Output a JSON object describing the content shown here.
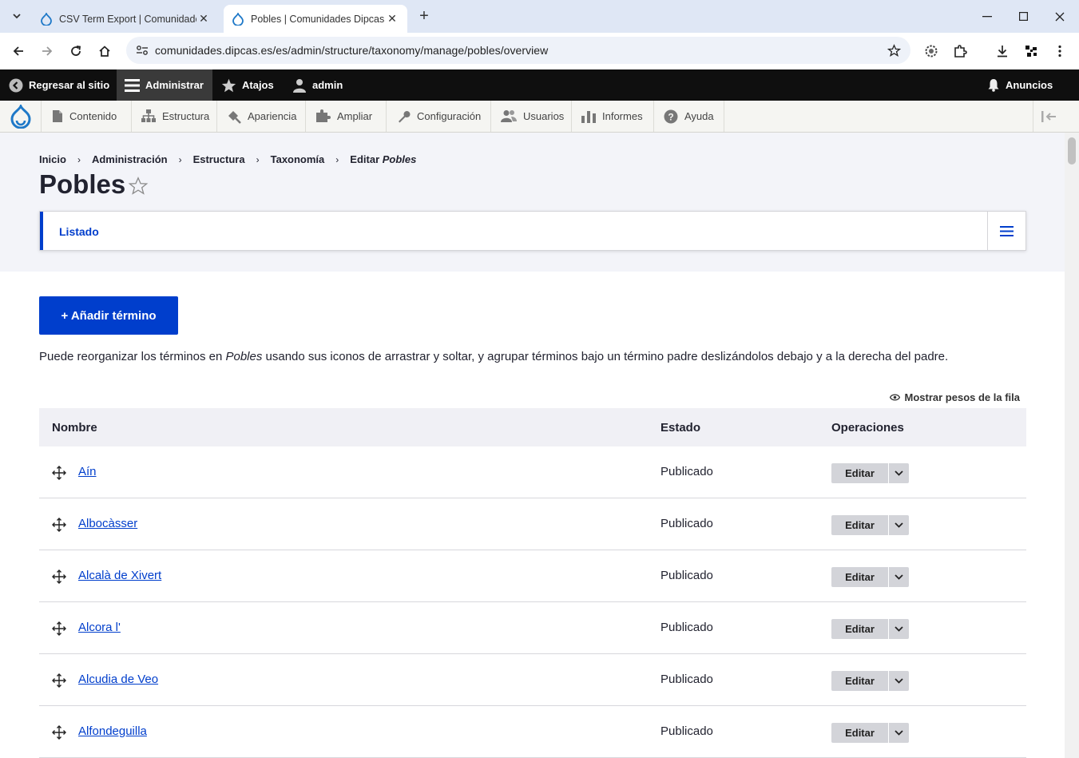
{
  "browser": {
    "tabs": [
      {
        "title": "CSV Term Export | Comunidade",
        "active": false
      },
      {
        "title": "Pobles | Comunidades Dipcas",
        "active": true
      }
    ],
    "url": "comunidades.dipcas.es/es/admin/structure/taxonomy/manage/pobles/overview"
  },
  "admin_toolbar": {
    "back": "Regresar al sitio",
    "manage": "Administrar",
    "shortcuts": "Atajos",
    "user": "admin",
    "announcements": "Anuncios"
  },
  "tray": {
    "items": [
      {
        "label": "Contenido",
        "icon": "file-icon"
      },
      {
        "label": "Estructura",
        "icon": "sitemap-icon"
      },
      {
        "label": "Apariencia",
        "icon": "paintbrush-icon"
      },
      {
        "label": "Ampliar",
        "icon": "puzzle-icon"
      },
      {
        "label": "Configuración",
        "icon": "wrench-icon"
      },
      {
        "label": "Usuarios",
        "icon": "users-icon"
      },
      {
        "label": "Informes",
        "icon": "chart-icon"
      },
      {
        "label": "Ayuda",
        "icon": "help-icon"
      }
    ]
  },
  "breadcrumb": {
    "items": [
      "Inicio",
      "Administración",
      "Estructura",
      "Taxonomía"
    ],
    "last_prefix": "Editar",
    "last_em": "Pobles"
  },
  "page": {
    "title": "Pobles",
    "tab_listado": "Listado",
    "add_button": "+ Añadir término",
    "help_before": "Puede reorganizar los términos en ",
    "help_em": "Pobles",
    "help_after": " usando sus iconos de arrastrar y soltar, y agrupar términos bajo un término padre deslizándolos debajo y a la derecha del padre.",
    "show_weights": "Mostrar pesos de la fila"
  },
  "table": {
    "headers": {
      "name": "Nombre",
      "status": "Estado",
      "operations": "Operaciones"
    },
    "edit_label": "Editar",
    "rows": [
      {
        "name": "Aín",
        "status": "Publicado"
      },
      {
        "name": "Albocàsser",
        "status": "Publicado"
      },
      {
        "name": "Alcalà de Xivert",
        "status": "Publicado"
      },
      {
        "name": "Alcora l'",
        "status": "Publicado"
      },
      {
        "name": "Alcudia de Veo",
        "status": "Publicado"
      },
      {
        "name": "Alfondeguilla",
        "status": "Publicado"
      }
    ]
  },
  "colors": {
    "accent": "#003ecc",
    "admin_bar": "#0f0f0f",
    "header_bg": "#f3f4f9"
  }
}
